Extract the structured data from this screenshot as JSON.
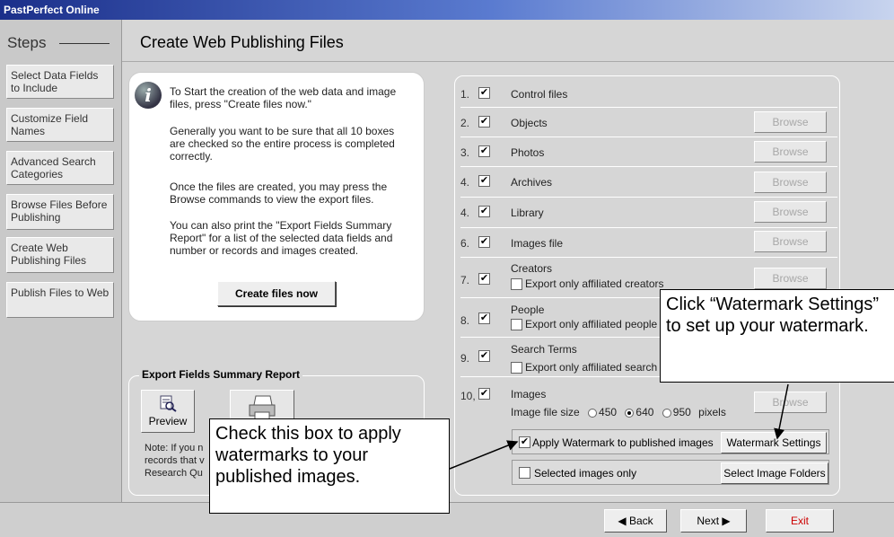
{
  "app": {
    "title": "PastPerfect Online"
  },
  "sidebar": {
    "title": "Steps",
    "items": [
      {
        "label": "Select Data Fields to Include"
      },
      {
        "label": "Customize Field Names"
      },
      {
        "label": "Advanced Search Categories"
      },
      {
        "label": "Browse Files Before Publishing"
      },
      {
        "label": "Create Web Publishing Files"
      },
      {
        "label": "Publish Files to Web"
      }
    ]
  },
  "header": {
    "title": "Create Web Publishing Files"
  },
  "info": {
    "paragraphs": [
      "To Start the creation of the web data and image files, press \"Create files now.\"",
      "Generally you want to be sure that all 10 boxes are checked so the entire process is completed correctly.",
      "Once the files are created, you may press the Browse commands to view the export files.",
      "You can also print the \"Export Fields Summary Report\" for a list of the selected data fields and number or records and images created."
    ],
    "create_button": "Create files now"
  },
  "export": {
    "legend": "Export Fields Summary Report",
    "preview_label": "Preview",
    "note_lines": [
      "Note: If you n",
      "records that v",
      "Research Qu"
    ]
  },
  "rows": [
    {
      "num": "1.",
      "label": "Control files"
    },
    {
      "num": "2.",
      "label": "Objects",
      "browse": "Browse"
    },
    {
      "num": "3.",
      "label": "Photos",
      "browse": "Browse"
    },
    {
      "num": "4.",
      "label": "Archives",
      "browse": "Browse"
    },
    {
      "num": "4.",
      "label": "Library",
      "browse": "Browse"
    },
    {
      "num": "6.",
      "label": "Images file",
      "browse": "Browse"
    },
    {
      "num": "7.",
      "label": "Creators",
      "sub": "Export only affiliated creators",
      "browse": "Browse"
    },
    {
      "num": "8.",
      "label": "People",
      "sub": "Export only affiliated people"
    },
    {
      "num": "9.",
      "label": "Search Terms",
      "sub": "Export only affiliated search"
    },
    {
      "num": "10,",
      "label": "Images",
      "browse": "Browse"
    }
  ],
  "images": {
    "size_label": "Image file size",
    "sizes": [
      "450",
      "640",
      "950"
    ],
    "selected_size": "640",
    "units": "pixels",
    "watermark_label": "Apply Watermark to published images",
    "watermark_button": "Watermark Settings",
    "selected_only_label": "Selected images only",
    "select_folders_button": "Select Image Folders"
  },
  "footer": {
    "back": "Back",
    "next": "Next",
    "exit": "Exit"
  },
  "callouts": {
    "watermark": "Click “Watermark Settings” to set up your watermark.",
    "checkbox": "Check this box to apply watermarks to your published images."
  },
  "colors": {
    "titlebar": "#1b2f8a",
    "disabled_text": "#a8a8a8",
    "exit_text": "#cc0000"
  }
}
